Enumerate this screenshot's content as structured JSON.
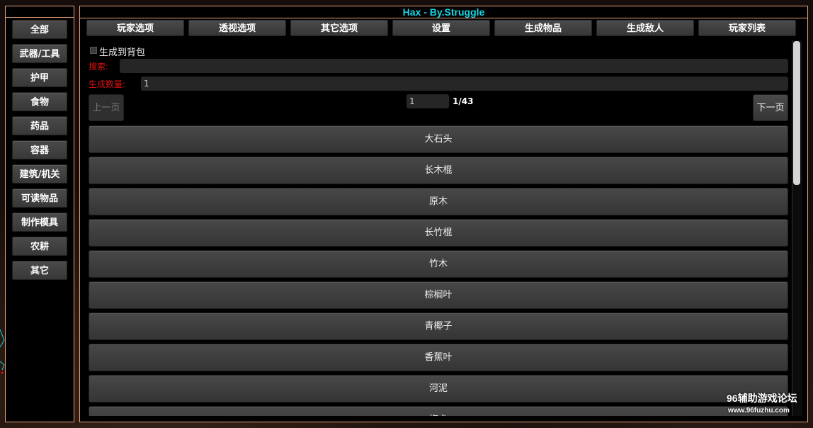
{
  "window": {
    "title": "Hax - By.Struggle"
  },
  "categories": [
    {
      "label": "全部"
    },
    {
      "label": "武器/工具"
    },
    {
      "label": "护甲"
    },
    {
      "label": "食物"
    },
    {
      "label": "药品"
    },
    {
      "label": "容器"
    },
    {
      "label": "建筑/机关"
    },
    {
      "label": "可读物品"
    },
    {
      "label": "制作模具"
    },
    {
      "label": "农耕"
    },
    {
      "label": "其它"
    }
  ],
  "tabs": [
    {
      "label": "玩家选项"
    },
    {
      "label": "透视选项"
    },
    {
      "label": "其它选项"
    },
    {
      "label": "设置"
    },
    {
      "label": "生成物品"
    },
    {
      "label": "生成敌人"
    },
    {
      "label": "玩家列表"
    }
  ],
  "spawn": {
    "to_backpack_label": "生成到背包",
    "to_backpack_checked": false,
    "search_label": "搜索:",
    "search_value": "",
    "quantity_label": "生成数量:",
    "quantity_value": "1"
  },
  "pagination": {
    "prev_label": "上一页",
    "next_label": "下一页",
    "page_input": "1",
    "page_count": "1/43"
  },
  "items": [
    {
      "label": "大石头"
    },
    {
      "label": "长木棍"
    },
    {
      "label": "原木"
    },
    {
      "label": "长竹棍"
    },
    {
      "label": "竹木"
    },
    {
      "label": "棕榈叶"
    },
    {
      "label": "青椰子"
    },
    {
      "label": "香蕉叶"
    },
    {
      "label": "河泥"
    },
    {
      "label": "梅卡"
    }
  ],
  "watermark": {
    "title": "96辅助游戏论坛",
    "url": "www.96fuzhu.com"
  },
  "colors": {
    "accent_border": "#e8a078",
    "title_text": "#19d6e6",
    "label_red": "#e01010"
  }
}
